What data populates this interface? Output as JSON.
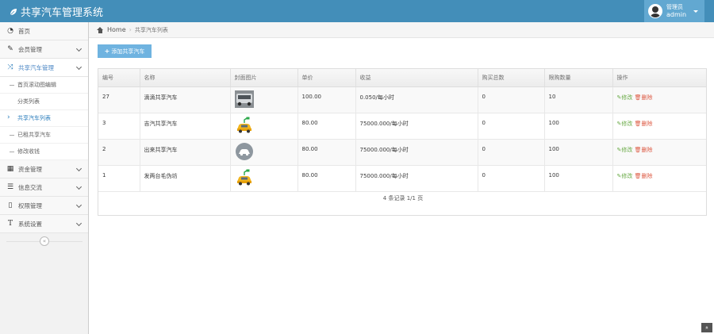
{
  "app": {
    "title": "共享汽车管理系统"
  },
  "user": {
    "role": "管理员",
    "name": "admin"
  },
  "sidebar": {
    "items": [
      {
        "label": "首页",
        "icon": "dashboard-icon"
      },
      {
        "label": "会员管理",
        "icon": "edit-icon"
      },
      {
        "label": "共享汽车管理",
        "icon": "shuffle-icon"
      },
      {
        "label": "资金管理",
        "icon": "calendar-icon"
      },
      {
        "label": "信息交流",
        "icon": "list-icon"
      },
      {
        "label": "权限管理",
        "icon": "file-icon"
      },
      {
        "label": "系统设置",
        "icon": "text-icon"
      }
    ],
    "subitems": [
      {
        "label": "首页滚动图编辑"
      },
      {
        "label": "分类列表"
      },
      {
        "label": "共享汽车列表"
      },
      {
        "label": "已租共享汽车"
      },
      {
        "label": "修改收钱"
      }
    ],
    "collapse_label": "«"
  },
  "breadcrumb": {
    "home": "Home",
    "current": "共享汽车列表"
  },
  "toolbar": {
    "add_label": "添加共享汽车"
  },
  "table": {
    "headers": [
      "编号",
      "名称",
      "封面图片",
      "单价",
      "收益",
      "购买总数",
      "限购数量",
      "操作"
    ],
    "rows": [
      {
        "id": "27",
        "name": "滴滴共享汽车",
        "image": "photo-car",
        "price": "100.00",
        "income": "0.050/每小时",
        "total": "0",
        "limit": "10"
      },
      {
        "id": "3",
        "name": "吉汽共享汽车",
        "image": "ev-yellow-car",
        "price": "80.00",
        "income": "75000.000/每小时",
        "total": "0",
        "limit": "100"
      },
      {
        "id": "2",
        "name": "出来共享汽车",
        "image": "car-circle",
        "price": "80.00",
        "income": "75000.000/每小时",
        "total": "0",
        "limit": "100"
      },
      {
        "id": "1",
        "name": "发两台毛伪坊",
        "image": "ev-yellow-car",
        "price": "80.00",
        "income": "75000.000/每小时",
        "total": "0",
        "limit": "100"
      }
    ],
    "edit_label": "修改",
    "delete_label": "删除"
  },
  "pagination": {
    "info": "4 条记录 1/1 页"
  },
  "colors": {
    "navbar": "#438eb9",
    "user_area": "#62a8d1",
    "add_button": "#6fb3e0",
    "edit": "#69aa46",
    "delete": "#dd5a43"
  }
}
